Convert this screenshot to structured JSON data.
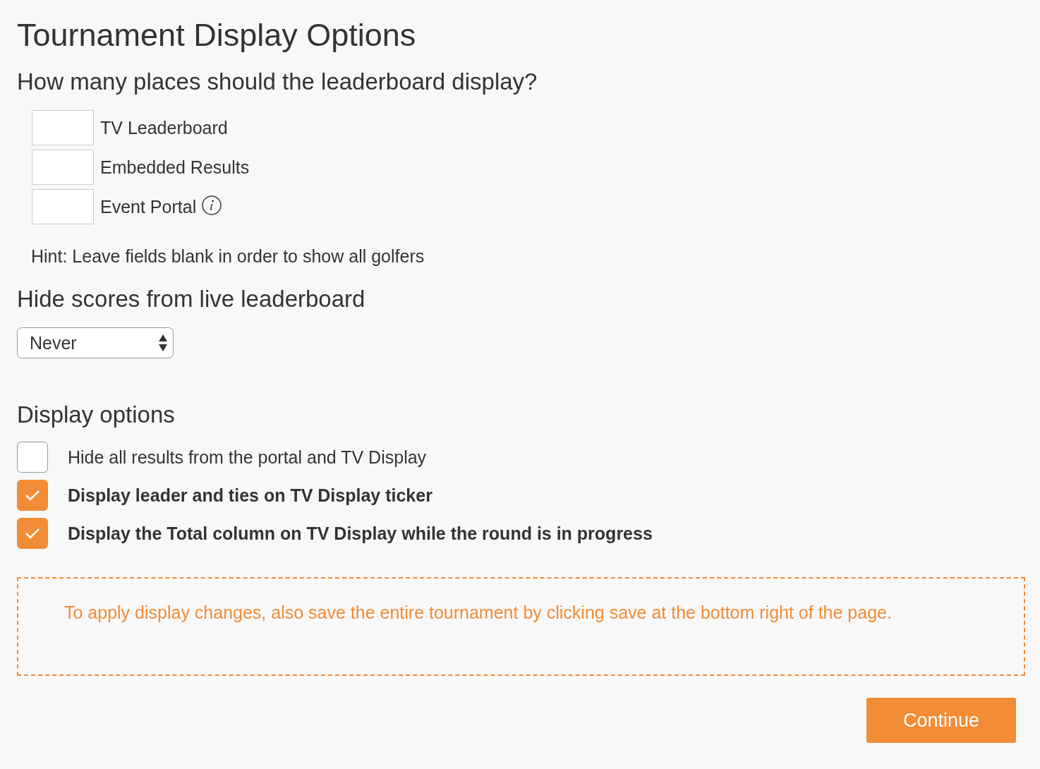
{
  "page": {
    "title": "Tournament Display Options"
  },
  "places": {
    "heading": "How many places should the leaderboard display?",
    "fields": [
      {
        "label": "TV Leaderboard",
        "info": false
      },
      {
        "label": "Embedded Results",
        "info": false
      },
      {
        "label": "Event Portal",
        "info": true
      }
    ],
    "hint": "Hint: Leave fields blank in order to show all golfers"
  },
  "hide_scores": {
    "heading": "Hide scores from live leaderboard",
    "select": {
      "value": "Never"
    }
  },
  "display_options": {
    "heading": "Display options",
    "items": [
      {
        "label": "Hide all results from the portal and TV Display",
        "checked": false
      },
      {
        "label": "Display leader and ties on TV Display ticker",
        "checked": true
      },
      {
        "label": "Display the Total column on TV Display while the round is in progress",
        "checked": true
      }
    ]
  },
  "notice": "To apply display changes, also save the entire tournament by clicking save at the bottom right of the page.",
  "buttons": [
    {
      "label": "Continue"
    }
  ]
}
